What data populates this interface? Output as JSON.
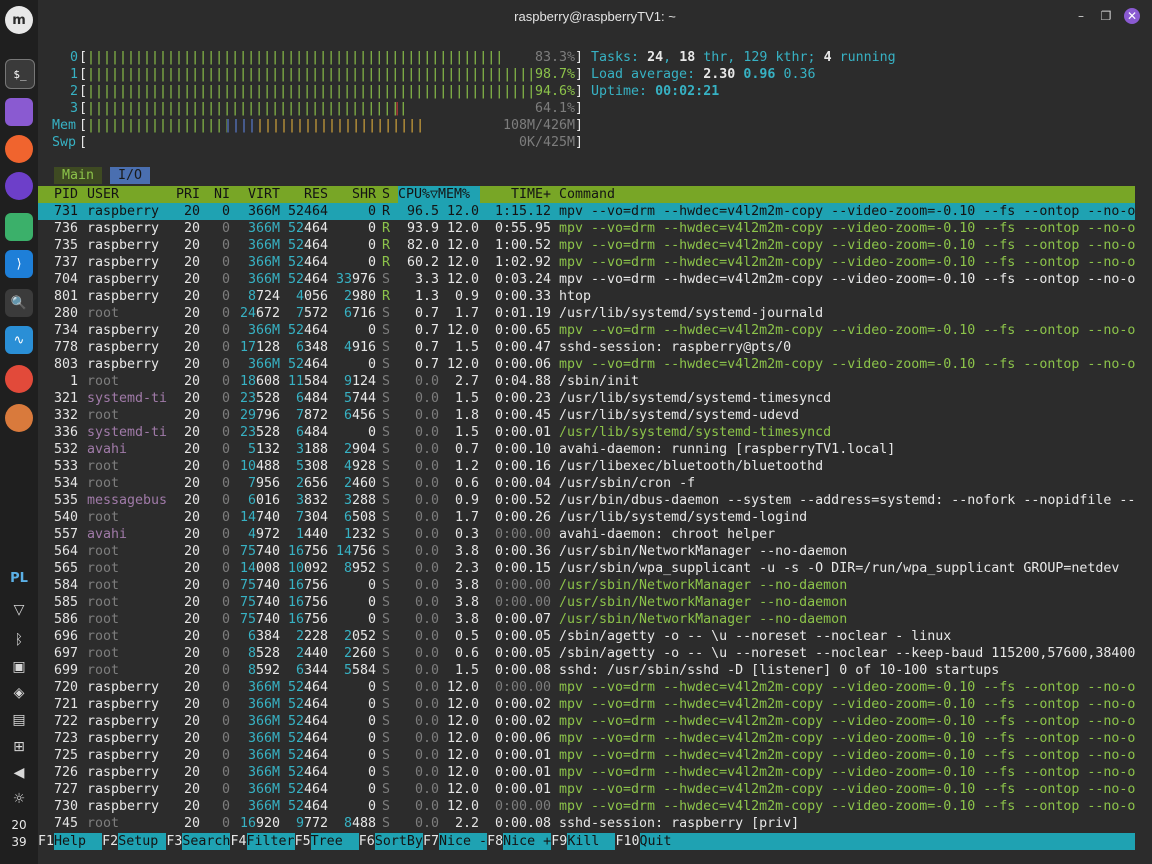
{
  "window": {
    "title": "raspberry@raspberryTV1: ~"
  },
  "dock": {
    "apps": [
      "mint-menu-icon",
      "terminal-icon",
      "files-icon",
      "firefox-icon",
      "app-icon",
      "settings-icon",
      "vscode-icon",
      "search-tool-icon",
      "monitor-icon",
      "chrome-icon",
      "chromium-icon"
    ],
    "keyboard_layout": "PL",
    "clock": {
      "hour": "20",
      "minute": "39"
    }
  },
  "meters": {
    "cpu": [
      {
        "id": "0",
        "bar": "||||||||||||||||||||||||||||||||||||||||||||||||||||",
        "pct": "83.3%",
        "level": 0.833
      },
      {
        "id": "1",
        "bar": "||||||||||||||||||||||||||||||||||||||||||||||||||||||||||||||",
        "pct": "98.7%",
        "level": 0.987
      },
      {
        "id": "2",
        "bar": "|||||||||||||||||||||||||||||||||||||||||||||||||||||||||||||",
        "pct": "94.6%",
        "level": 0.946
      },
      {
        "id": "3",
        "bar": "||||||||||||||||||||||||||||||||||||||||",
        "pct": "64.1%",
        "level": 0.641
      }
    ],
    "mem": {
      "label": "Mem",
      "green": "|||||||||||||||||||",
      "blue": "||||",
      "yellow": "||||||||||||||||||||||",
      "value": "108M/426M"
    },
    "swp": {
      "label": "Swp",
      "value": "0K/425M"
    },
    "tasks": {
      "label": "Tasks:",
      "count": "24",
      "thr": "18",
      "thr_label": "thr,",
      "kthr": "129",
      "kthr_label": "kthr;",
      "running": "4",
      "running_label": "running"
    },
    "load": {
      "label": "Load average:",
      "v1": "2.30",
      "v5": "0.96",
      "v15": "0.36"
    },
    "uptime": {
      "label": "Uptime:",
      "value": "00:02:21"
    }
  },
  "tabs": [
    "Main",
    "I/O"
  ],
  "columns": [
    "PID",
    "USER",
    "PRI",
    "NI",
    "VIRT",
    "RES",
    "SHR",
    "S",
    "CPU%▽MEM%",
    "TIME+",
    "Command"
  ],
  "processes": [
    {
      "pid": "731",
      "user": "raspberry",
      "pri": "20",
      "ni": "0",
      "virt": "366M",
      "res": "52464",
      "shr": "0",
      "s": "R",
      "cpu": "96.5",
      "mem": "12.0",
      "time": "1:15.12",
      "cmd": "mpv --vo=drm --hwdec=v4l2m2m-copy --video-zoom=-0.10 --fs --ontop --no-o",
      "thread": false,
      "sel": true
    },
    {
      "pid": "736",
      "user": "raspberry",
      "pri": "20",
      "ni": "0",
      "virt": "366M",
      "res": "52464",
      "shr": "0",
      "s": "R",
      "cpu": "93.9",
      "mem": "12.0",
      "time": "0:55.95",
      "cmd": "mpv --vo=drm --hwdec=v4l2m2m-copy --video-zoom=-0.10 --fs --ontop --no-o",
      "thread": true
    },
    {
      "pid": "735",
      "user": "raspberry",
      "pri": "20",
      "ni": "0",
      "virt": "366M",
      "res": "52464",
      "shr": "0",
      "s": "R",
      "cpu": "82.0",
      "mem": "12.0",
      "time": "1:00.52",
      "cmd": "mpv --vo=drm --hwdec=v4l2m2m-copy --video-zoom=-0.10 --fs --ontop --no-o",
      "thread": true
    },
    {
      "pid": "737",
      "user": "raspberry",
      "pri": "20",
      "ni": "0",
      "virt": "366M",
      "res": "52464",
      "shr": "0",
      "s": "R",
      "cpu": "60.2",
      "mem": "12.0",
      "time": "1:02.92",
      "cmd": "mpv --vo=drm --hwdec=v4l2m2m-copy --video-zoom=-0.10 --fs --ontop --no-o",
      "thread": true
    },
    {
      "pid": "704",
      "user": "raspberry",
      "pri": "20",
      "ni": "0",
      "virt": "366M",
      "res": "52464",
      "shr": "33976",
      "s": "S",
      "cpu": "3.3",
      "mem": "12.0",
      "time": "0:03.24",
      "cmd": "mpv --vo=drm --hwdec=v4l2m2m-copy --video-zoom=-0.10 --fs --ontop --no-o",
      "thread": false
    },
    {
      "pid": "801",
      "user": "raspberry",
      "pri": "20",
      "ni": "0",
      "virt": "8724",
      "res": "4056",
      "shr": "2980",
      "s": "R",
      "cpu": "1.3",
      "mem": "0.9",
      "time": "0:00.33",
      "cmd": "htop",
      "thread": false
    },
    {
      "pid": "280",
      "user": "root",
      "pri": "20",
      "ni": "0",
      "virt": "24672",
      "res": "7572",
      "shr": "6716",
      "s": "S",
      "cpu": "0.7",
      "mem": "1.7",
      "time": "0:01.19",
      "cmd": "/usr/lib/systemd/systemd-journald",
      "thread": false
    },
    {
      "pid": "734",
      "user": "raspberry",
      "pri": "20",
      "ni": "0",
      "virt": "366M",
      "res": "52464",
      "shr": "0",
      "s": "S",
      "cpu": "0.7",
      "mem": "12.0",
      "time": "0:00.65",
      "cmd": "mpv --vo=drm --hwdec=v4l2m2m-copy --video-zoom=-0.10 --fs --ontop --no-o",
      "thread": true
    },
    {
      "pid": "778",
      "user": "raspberry",
      "pri": "20",
      "ni": "0",
      "virt": "17128",
      "res": "6348",
      "shr": "4916",
      "s": "S",
      "cpu": "0.7",
      "mem": "1.5",
      "time": "0:00.47",
      "cmd": "sshd-session: raspberry@pts/0",
      "thread": false
    },
    {
      "pid": "803",
      "user": "raspberry",
      "pri": "20",
      "ni": "0",
      "virt": "366M",
      "res": "52464",
      "shr": "0",
      "s": "S",
      "cpu": "0.7",
      "mem": "12.0",
      "time": "0:00.06",
      "cmd": "mpv --vo=drm --hwdec=v4l2m2m-copy --video-zoom=-0.10 --fs --ontop --no-o",
      "thread": true
    },
    {
      "pid": "1",
      "user": "root",
      "pri": "20",
      "ni": "0",
      "virt": "18608",
      "res": "11584",
      "shr": "9124",
      "s": "S",
      "cpu": "0.0",
      "mem": "2.7",
      "time": "0:04.88",
      "cmd": "/sbin/init",
      "thread": false
    },
    {
      "pid": "321",
      "user": "systemd-ti",
      "pri": "20",
      "ni": "0",
      "virt": "23528",
      "res": "6484",
      "shr": "5744",
      "s": "S",
      "cpu": "0.0",
      "mem": "1.5",
      "time": "0:00.23",
      "cmd": "/usr/lib/systemd/systemd-timesyncd",
      "thread": false
    },
    {
      "pid": "332",
      "user": "root",
      "pri": "20",
      "ni": "0",
      "virt": "29796",
      "res": "7872",
      "shr": "6456",
      "s": "S",
      "cpu": "0.0",
      "mem": "1.8",
      "time": "0:00.45",
      "cmd": "/usr/lib/systemd/systemd-udevd",
      "thread": false
    },
    {
      "pid": "336",
      "user": "systemd-ti",
      "pri": "20",
      "ni": "0",
      "virt": "23528",
      "res": "6484",
      "shr": "0",
      "s": "S",
      "cpu": "0.0",
      "mem": "1.5",
      "time": "0:00.01",
      "cmd": "/usr/lib/systemd/systemd-timesyncd",
      "thread": true
    },
    {
      "pid": "532",
      "user": "avahi",
      "pri": "20",
      "ni": "0",
      "virt": "5132",
      "res": "3188",
      "shr": "2904",
      "s": "S",
      "cpu": "0.0",
      "mem": "0.7",
      "time": "0:00.10",
      "cmd": "avahi-daemon: running [raspberryTV1.local]",
      "thread": false
    },
    {
      "pid": "533",
      "user": "root",
      "pri": "20",
      "ni": "0",
      "virt": "10488",
      "res": "5308",
      "shr": "4928",
      "s": "S",
      "cpu": "0.0",
      "mem": "1.2",
      "time": "0:00.16",
      "cmd": "/usr/libexec/bluetooth/bluetoothd",
      "thread": false
    },
    {
      "pid": "534",
      "user": "root",
      "pri": "20",
      "ni": "0",
      "virt": "7956",
      "res": "2656",
      "shr": "2460",
      "s": "S",
      "cpu": "0.0",
      "mem": "0.6",
      "time": "0:00.04",
      "cmd": "/usr/sbin/cron -f",
      "thread": false
    },
    {
      "pid": "535",
      "user": "messagebus",
      "pri": "20",
      "ni": "0",
      "virt": "6016",
      "res": "3832",
      "shr": "3288",
      "s": "S",
      "cpu": "0.0",
      "mem": "0.9",
      "time": "0:00.52",
      "cmd": "/usr/bin/dbus-daemon --system --address=systemd: --nofork --nopidfile --",
      "thread": false
    },
    {
      "pid": "540",
      "user": "root",
      "pri": "20",
      "ni": "0",
      "virt": "14740",
      "res": "7304",
      "shr": "6508",
      "s": "S",
      "cpu": "0.0",
      "mem": "1.7",
      "time": "0:00.26",
      "cmd": "/usr/lib/systemd/systemd-logind",
      "thread": false
    },
    {
      "pid": "557",
      "user": "avahi",
      "pri": "20",
      "ni": "0",
      "virt": "4972",
      "res": "1440",
      "shr": "1232",
      "s": "S",
      "cpu": "0.0",
      "mem": "0.3",
      "time": "0:00.00",
      "cmd": "avahi-daemon: chroot helper",
      "thread": false
    },
    {
      "pid": "564",
      "user": "root",
      "pri": "20",
      "ni": "0",
      "virt": "75740",
      "res": "16756",
      "shr": "14756",
      "s": "S",
      "cpu": "0.0",
      "mem": "3.8",
      "time": "0:00.36",
      "cmd": "/usr/sbin/NetworkManager --no-daemon",
      "thread": false
    },
    {
      "pid": "565",
      "user": "root",
      "pri": "20",
      "ni": "0",
      "virt": "14008",
      "res": "10092",
      "shr": "8952",
      "s": "S",
      "cpu": "0.0",
      "mem": "2.3",
      "time": "0:00.15",
      "cmd": "/usr/sbin/wpa_supplicant -u -s -O DIR=/run/wpa_supplicant GROUP=netdev",
      "thread": false
    },
    {
      "pid": "584",
      "user": "root",
      "pri": "20",
      "ni": "0",
      "virt": "75740",
      "res": "16756",
      "shr": "0",
      "s": "S",
      "cpu": "0.0",
      "mem": "3.8",
      "time": "0:00.00",
      "cmd": "/usr/sbin/NetworkManager --no-daemon",
      "thread": true
    },
    {
      "pid": "585",
      "user": "root",
      "pri": "20",
      "ni": "0",
      "virt": "75740",
      "res": "16756",
      "shr": "0",
      "s": "S",
      "cpu": "0.0",
      "mem": "3.8",
      "time": "0:00.00",
      "cmd": "/usr/sbin/NetworkManager --no-daemon",
      "thread": true
    },
    {
      "pid": "586",
      "user": "root",
      "pri": "20",
      "ni": "0",
      "virt": "75740",
      "res": "16756",
      "shr": "0",
      "s": "S",
      "cpu": "0.0",
      "mem": "3.8",
      "time": "0:00.07",
      "cmd": "/usr/sbin/NetworkManager --no-daemon",
      "thread": true
    },
    {
      "pid": "696",
      "user": "root",
      "pri": "20",
      "ni": "0",
      "virt": "6384",
      "res": "2228",
      "shr": "2052",
      "s": "S",
      "cpu": "0.0",
      "mem": "0.5",
      "time": "0:00.05",
      "cmd": "/sbin/agetty -o -- \\u --noreset --noclear - linux",
      "thread": false
    },
    {
      "pid": "697",
      "user": "root",
      "pri": "20",
      "ni": "0",
      "virt": "8528",
      "res": "2440",
      "shr": "2260",
      "s": "S",
      "cpu": "0.0",
      "mem": "0.6",
      "time": "0:00.05",
      "cmd": "/sbin/agetty -o -- \\u --noreset --noclear --keep-baud 115200,57600,38400",
      "thread": false
    },
    {
      "pid": "699",
      "user": "root",
      "pri": "20",
      "ni": "0",
      "virt": "8592",
      "res": "6344",
      "shr": "5584",
      "s": "S",
      "cpu": "0.0",
      "mem": "1.5",
      "time": "0:00.08",
      "cmd": "sshd: /usr/sbin/sshd -D [listener] 0 of 10-100 startups",
      "thread": false
    },
    {
      "pid": "720",
      "user": "raspberry",
      "pri": "20",
      "ni": "0",
      "virt": "366M",
      "res": "52464",
      "shr": "0",
      "s": "S",
      "cpu": "0.0",
      "mem": "12.0",
      "time": "0:00.00",
      "cmd": "mpv --vo=drm --hwdec=v4l2m2m-copy --video-zoom=-0.10 --fs --ontop --no-o",
      "thread": true
    },
    {
      "pid": "721",
      "user": "raspberry",
      "pri": "20",
      "ni": "0",
      "virt": "366M",
      "res": "52464",
      "shr": "0",
      "s": "S",
      "cpu": "0.0",
      "mem": "12.0",
      "time": "0:00.02",
      "cmd": "mpv --vo=drm --hwdec=v4l2m2m-copy --video-zoom=-0.10 --fs --ontop --no-o",
      "thread": true
    },
    {
      "pid": "722",
      "user": "raspberry",
      "pri": "20",
      "ni": "0",
      "virt": "366M",
      "res": "52464",
      "shr": "0",
      "s": "S",
      "cpu": "0.0",
      "mem": "12.0",
      "time": "0:00.02",
      "cmd": "mpv --vo=drm --hwdec=v4l2m2m-copy --video-zoom=-0.10 --fs --ontop --no-o",
      "thread": true
    },
    {
      "pid": "723",
      "user": "raspberry",
      "pri": "20",
      "ni": "0",
      "virt": "366M",
      "res": "52464",
      "shr": "0",
      "s": "S",
      "cpu": "0.0",
      "mem": "12.0",
      "time": "0:00.06",
      "cmd": "mpv --vo=drm --hwdec=v4l2m2m-copy --video-zoom=-0.10 --fs --ontop --no-o",
      "thread": true
    },
    {
      "pid": "725",
      "user": "raspberry",
      "pri": "20",
      "ni": "0",
      "virt": "366M",
      "res": "52464",
      "shr": "0",
      "s": "S",
      "cpu": "0.0",
      "mem": "12.0",
      "time": "0:00.01",
      "cmd": "mpv --vo=drm --hwdec=v4l2m2m-copy --video-zoom=-0.10 --fs --ontop --no-o",
      "thread": true
    },
    {
      "pid": "726",
      "user": "raspberry",
      "pri": "20",
      "ni": "0",
      "virt": "366M",
      "res": "52464",
      "shr": "0",
      "s": "S",
      "cpu": "0.0",
      "mem": "12.0",
      "time": "0:00.01",
      "cmd": "mpv --vo=drm --hwdec=v4l2m2m-copy --video-zoom=-0.10 --fs --ontop --no-o",
      "thread": true
    },
    {
      "pid": "727",
      "user": "raspberry",
      "pri": "20",
      "ni": "0",
      "virt": "366M",
      "res": "52464",
      "shr": "0",
      "s": "S",
      "cpu": "0.0",
      "mem": "12.0",
      "time": "0:00.01",
      "cmd": "mpv --vo=drm --hwdec=v4l2m2m-copy --video-zoom=-0.10 --fs --ontop --no-o",
      "thread": true
    },
    {
      "pid": "730",
      "user": "raspberry",
      "pri": "20",
      "ni": "0",
      "virt": "366M",
      "res": "52464",
      "shr": "0",
      "s": "S",
      "cpu": "0.0",
      "mem": "12.0",
      "time": "0:00.00",
      "cmd": "mpv --vo=drm --hwdec=v4l2m2m-copy --video-zoom=-0.10 --fs --ontop --no-o",
      "thread": true
    },
    {
      "pid": "745",
      "user": "root",
      "pri": "20",
      "ni": "0",
      "virt": "16920",
      "res": "9772",
      "shr": "8488",
      "s": "S",
      "cpu": "0.0",
      "mem": "2.2",
      "time": "0:00.08",
      "cmd": "sshd-session: raspberry [priv]",
      "thread": false
    }
  ],
  "fkeys": [
    {
      "key": "F1",
      "label": "Help  "
    },
    {
      "key": "F2",
      "label": "Setup "
    },
    {
      "key": "F3",
      "label": "Search"
    },
    {
      "key": "F4",
      "label": "Filter"
    },
    {
      "key": "F5",
      "label": "Tree  "
    },
    {
      "key": "F6",
      "label": "SortBy"
    },
    {
      "key": "F7",
      "label": "Nice -"
    },
    {
      "key": "F8",
      "label": "Nice +"
    },
    {
      "key": "F9",
      "label": "Kill  "
    },
    {
      "key": "F10",
      "label": "Quit"
    }
  ],
  "colors": {
    "header_bg": "#78a626",
    "selected_bg": "#1fa2b2",
    "fkey_bg": "#1fa2b2",
    "meter_green": "#8cc34a",
    "meter_red": "#d13a3a",
    "accent_close": "#8a5ad1"
  }
}
